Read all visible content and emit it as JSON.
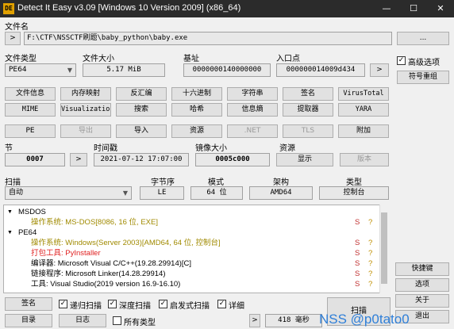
{
  "window": {
    "title": "Detect It Easy v3.09 [Windows 10 Version 2009] (x86_64)",
    "icon_label": "DE",
    "minimize_glyph": "—",
    "maximize_glyph": "☐",
    "close_glyph": "✕"
  },
  "file": {
    "label": "文件名",
    "browse_label": ">",
    "path": "F:\\CTF\\NSSCTF刷题\\baby_python\\baby.exe",
    "more_label": "..."
  },
  "info": {
    "type_label": "文件类型",
    "type_value": "PE64",
    "size_label": "文件大小",
    "size_value": "5.17 MiB",
    "base_label": "基址",
    "base_value": "0000000140000000",
    "entry_label": "入口点",
    "entry_value": "000000014009d434",
    "entry_btn": ">",
    "advanced_label": "高级选项",
    "advanced_checked": true,
    "symbol_btn": "符号重组"
  },
  "tools_row1": [
    "文件信息",
    "内存映射",
    "反汇编",
    "十六进制",
    "字符串",
    "签名",
    "VirusTotal"
  ],
  "tools_row2": [
    "MIME",
    "Visualization",
    "搜索",
    "哈希",
    "信息熵",
    "提取器",
    "YARA"
  ],
  "tools_row3": [
    {
      "label": "PE",
      "enabled": true
    },
    {
      "label": "导出",
      "enabled": false
    },
    {
      "label": "导入",
      "enabled": true
    },
    {
      "label": "资源",
      "enabled": true
    },
    {
      "label": ".NET",
      "enabled": false
    },
    {
      "label": "TLS",
      "enabled": false
    },
    {
      "label": "附加",
      "enabled": true
    }
  ],
  "sections": {
    "label": "节",
    "value": "0007",
    "btn": ">",
    "timestamp_label": "时间戳",
    "timestamp_value": "2021-07-12 17:07:00",
    "image_size_label": "镜像大小",
    "image_size_value": "0005c000",
    "resources_label": "资源",
    "show_btn": "显示",
    "version_btn": "版本"
  },
  "scan": {
    "label": "扫描",
    "mode": "自动",
    "endian_label": "字节序",
    "endian_value": "LE",
    "mode_label": "模式",
    "mode_value": "64 位",
    "arch_label": "架构",
    "arch_value": "AMD64",
    "type_label": "类型",
    "type_value": "控制台"
  },
  "results": {
    "msdos_header": "MSDOS",
    "msdos_os": "操作系统: MS-DOS[8086, 16 位, EXE]",
    "pe64_header": "PE64",
    "items": [
      {
        "text": "操作系统: Windows(Server 2003)[AMD64, 64 位, 控制台]",
        "color": "olive",
        "s": "S",
        "q": "?"
      },
      {
        "text": "打包工具: PyInstaller",
        "color": "red",
        "s": "S",
        "q": "?"
      },
      {
        "text": "编译器: Microsoft Visual C/C++(19.28.29914)[C]",
        "color": "black",
        "s": "S",
        "q": "?"
      },
      {
        "text": "链接程序: Microsoft Linker(14.28.29914)",
        "color": "black",
        "s": "S",
        "q": "?"
      },
      {
        "text": "工具: Visual Studio(2019 version 16.9-16.10)",
        "color": "black",
        "s": "S",
        "q": "?"
      }
    ],
    "msdos_s": "S",
    "msdos_q": "?"
  },
  "side_buttons": {
    "shortcuts": "快捷键",
    "options": "选项",
    "about": "关于",
    "exit": "退出"
  },
  "bottom": {
    "signature_btn": "签名",
    "recursive_label": "递归扫描",
    "recursive_checked": true,
    "deep_label": "深度扫描",
    "deep_checked": true,
    "heuristic_label": "启发式扫描",
    "heuristic_checked": true,
    "verbose_label": "详细",
    "verbose_checked": true,
    "directory_btn": "目录",
    "log_btn": "日志",
    "all_types_label": "所有类型",
    "all_types_checked": false,
    "elapsed_btn_glyph": ">",
    "elapsed": "418 毫秒",
    "scan_btn": "扫描"
  },
  "watermark": "NSS @p0tato0",
  "check_glyph": "✓"
}
